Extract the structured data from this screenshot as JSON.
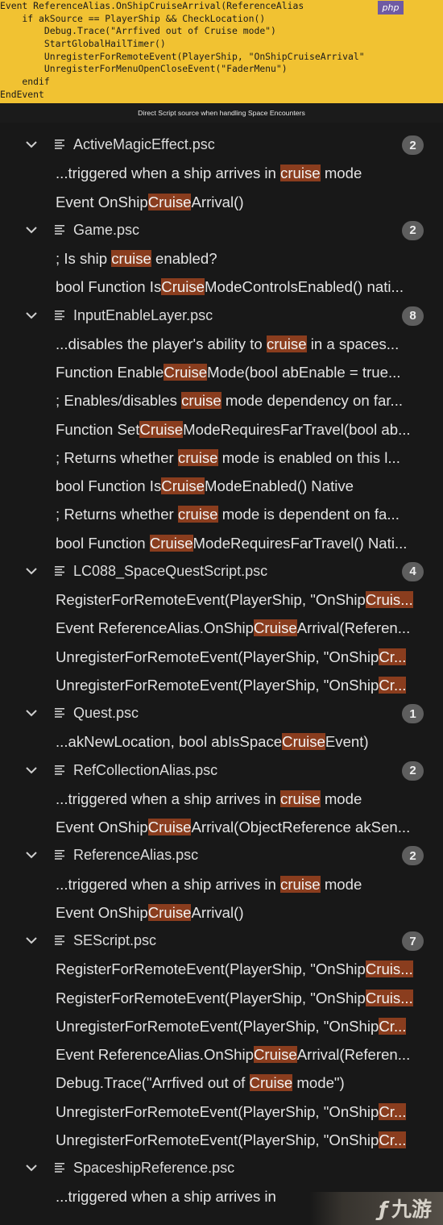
{
  "code_panel": {
    "lines": [
      "Event ReferenceAlias.OnShipCruiseArrival(ReferenceAlias",
      "    if akSource == PlayerShip && CheckLocation()",
      "        Debug.Trace(\"Arrfived out of Cruise mode\")",
      "        StartGlobalHailTimer()",
      "        UnregisterForRemoteEvent(PlayerShip, \"OnShipCruiseArrival\"",
      "        UnregisterForMenuOpenCloseEvent(\"FaderMenu\")",
      "    endif",
      "EndEvent"
    ],
    "badge": "php"
  },
  "caption": "Direct Script source when handling Space Encounters",
  "results": [
    {
      "file": "ActiveMagicEffect.psc",
      "count": "2",
      "matches": [
        {
          "pre": "...triggered when a ship arrives in ",
          "hl": "cruise",
          "post": " mode"
        },
        {
          "pre": "Event OnShip",
          "hl": "Cruise",
          "post": "Arrival()"
        }
      ]
    },
    {
      "file": "Game.psc",
      "count": "2",
      "matches": [
        {
          "pre": "; Is ship ",
          "hl": "cruise",
          "post": " enabled?"
        },
        {
          "pre": "bool Function Is",
          "hl": "Cruise",
          "post": "ModeControlsEnabled() nati..."
        }
      ]
    },
    {
      "file": "InputEnableLayer.psc",
      "count": "8",
      "matches": [
        {
          "pre": "...disables the player's ability to ",
          "hl": "cruise",
          "post": " in a spaces..."
        },
        {
          "pre": "Function Enable",
          "hl": "Cruise",
          "post": "Mode(bool abEnable = true..."
        },
        {
          "pre": "; Enables/disables ",
          "hl": "cruise",
          "post": " mode dependency on far..."
        },
        {
          "pre": "Function Set",
          "hl": "Cruise",
          "post": "ModeRequiresFarTravel(bool ab..."
        },
        {
          "pre": "; Returns whether ",
          "hl": "cruise",
          "post": " mode is enabled on this l..."
        },
        {
          "pre": "bool Function Is",
          "hl": "Cruise",
          "post": "ModeEnabled() Native"
        },
        {
          "pre": "; Returns whether ",
          "hl": "cruise",
          "post": " mode is dependent on fa..."
        },
        {
          "pre": "bool Function ",
          "hl": "Cruise",
          "post": "ModeRequiresFarTravel() Nati..."
        }
      ]
    },
    {
      "file": "LC088_SpaceQuestScript.psc",
      "count": "4",
      "matches": [
        {
          "pre": "RegisterForRemoteEvent(PlayerShip, \"OnShip",
          "hl": "Cruis...",
          "post": ""
        },
        {
          "pre": "Event ReferenceAlias.OnShip",
          "hl": "Cruise",
          "post": "Arrival(Referen..."
        },
        {
          "pre": "UnregisterForRemoteEvent(PlayerShip, \"OnShip",
          "hl": "Cr...",
          "post": ""
        },
        {
          "pre": "UnregisterForRemoteEvent(PlayerShip, \"OnShip",
          "hl": "Cr...",
          "post": ""
        }
      ]
    },
    {
      "file": "Quest.psc",
      "count": "1",
      "matches": [
        {
          "pre": "...akNewLocation, bool abIsSpace",
          "hl": "Cruise",
          "post": "Event)"
        }
      ]
    },
    {
      "file": "RefCollectionAlias.psc",
      "count": "2",
      "matches": [
        {
          "pre": "...triggered when a ship arrives in ",
          "hl": "cruise",
          "post": " mode"
        },
        {
          "pre": "Event OnShip",
          "hl": "Cruise",
          "post": "Arrival(ObjectReference akSen..."
        }
      ]
    },
    {
      "file": "ReferenceAlias.psc",
      "count": "2",
      "matches": [
        {
          "pre": "...triggered when a ship arrives in ",
          "hl": "cruise",
          "post": " mode"
        },
        {
          "pre": "Event OnShip",
          "hl": "Cruise",
          "post": "Arrival()"
        }
      ]
    },
    {
      "file": "SEScript.psc",
      "count": "7",
      "matches": [
        {
          "pre": "RegisterForRemoteEvent(PlayerShip, \"OnShip",
          "hl": "Cruis...",
          "post": ""
        },
        {
          "pre": "RegisterForRemoteEvent(PlayerShip, \"OnShip",
          "hl": "Cruis...",
          "post": ""
        },
        {
          "pre": "UnregisterForRemoteEvent(PlayerShip, \"OnShip",
          "hl": "Cr...",
          "post": ""
        },
        {
          "pre": "Event ReferenceAlias.OnShip",
          "hl": "Cruise",
          "post": "Arrival(Referen..."
        },
        {
          "pre": "Debug.Trace(\"Arrfived out of ",
          "hl": "Cruise",
          "post": " mode\")"
        },
        {
          "pre": "UnregisterForRemoteEvent(PlayerShip, \"OnShip",
          "hl": "Cr...",
          "post": ""
        },
        {
          "pre": "UnregisterForRemoteEvent(PlayerShip, \"OnShip",
          "hl": "Cr...",
          "post": ""
        }
      ]
    },
    {
      "file": "SpaceshipReference.psc",
      "count": "",
      "matches": [
        {
          "pre": "...triggered when a ship arrives in ",
          "hl": "",
          "post": ""
        }
      ]
    }
  ],
  "watermark": {
    "logo_text": "九游"
  },
  "colors": {
    "code_background": "#f1c232",
    "panel_background": "#181818",
    "highlight": "#8a3d1e",
    "count_badge": "#5e5e5e",
    "php_badge": "#6f5aa3"
  },
  "icons": {
    "expand": "chevron-down-icon",
    "file": "file-lines-icon",
    "watermark": "watermark-logo-icon"
  }
}
